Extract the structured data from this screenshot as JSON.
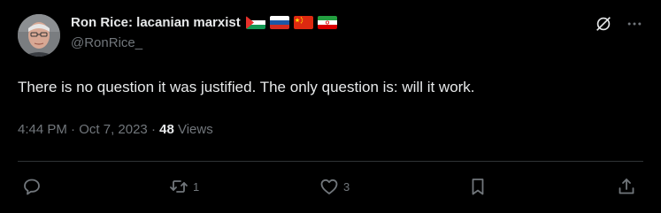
{
  "author": {
    "display_name": "Ron Rice: lacanian marxist",
    "handle": "@RonRice_",
    "flags": [
      "palestine-flag",
      "russia-flag",
      "china-flag",
      "iran-flag"
    ]
  },
  "tweet": {
    "text": "There is no question it was justified. The only question is: will it work."
  },
  "meta": {
    "time": "4:44 PM",
    "separator1": " · ",
    "date": "Oct 7, 2023",
    "separator2": " · ",
    "views_count": "48",
    "views_label": " Views"
  },
  "actions": {
    "reply_count": "",
    "retweet_count": "1",
    "like_count": "3"
  },
  "colors": {
    "background": "#000000",
    "text_primary": "#e7e9ea",
    "text_secondary": "#71767b",
    "divider": "#2f3336"
  }
}
